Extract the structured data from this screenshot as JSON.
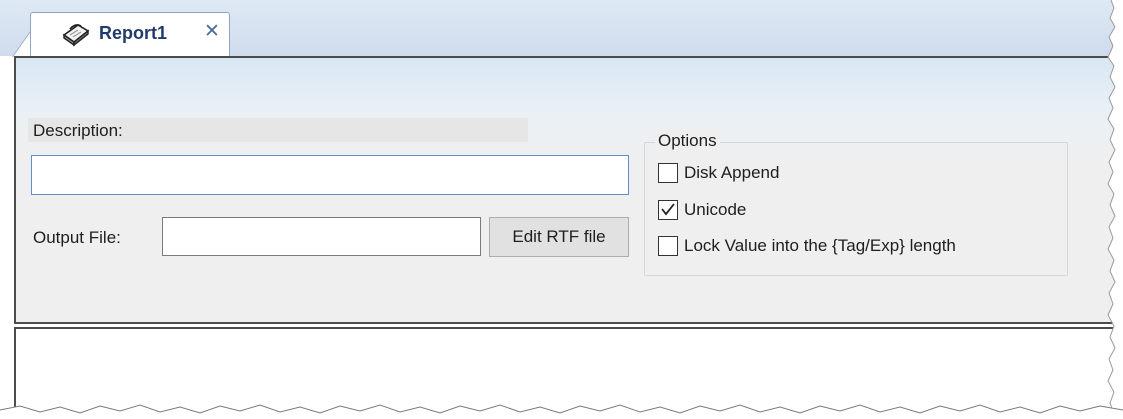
{
  "tab": {
    "title": "Report1",
    "close_glyph": "✕",
    "icon": "report-icon"
  },
  "form": {
    "description_label": "Description:",
    "description_value": "",
    "output_file_label": "Output File:",
    "output_file_value": "",
    "edit_rtf_label": "Edit RTF file"
  },
  "options": {
    "title": "Options",
    "items": [
      {
        "label": "Disk Append",
        "checked": false
      },
      {
        "label": "Unicode",
        "checked": true
      },
      {
        "label": "Lock Value into the {Tag/Exp} length",
        "checked": false
      }
    ]
  },
  "colors": {
    "tab_title": "#1f3b6b",
    "input_focus_border": "#5b8fd2",
    "panel_bg": "#efefef"
  }
}
